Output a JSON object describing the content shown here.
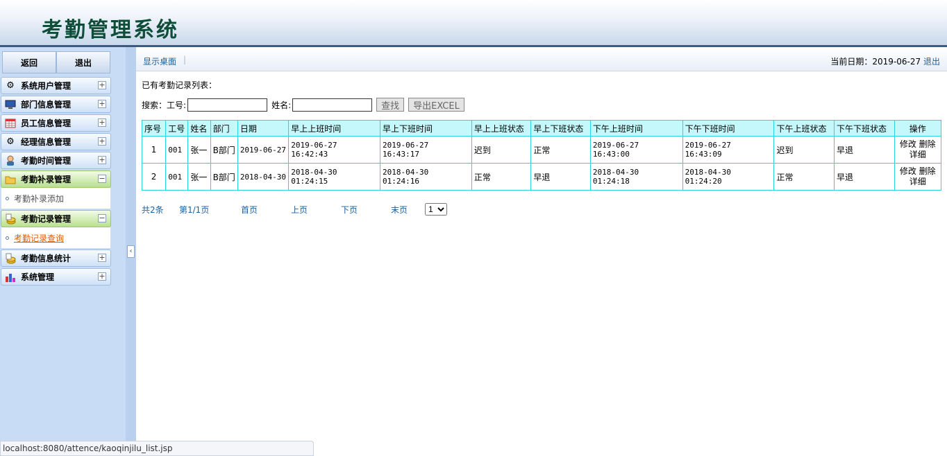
{
  "app": {
    "title": "考勤管理系统"
  },
  "sidebar": {
    "back_label": "返回",
    "exit_label": "退出",
    "menu": [
      {
        "label": "系统用户管理",
        "icon": "gear-icon",
        "state": "collapsed"
      },
      {
        "label": "部门信息管理",
        "icon": "monitor-icon",
        "state": "collapsed"
      },
      {
        "label": "员工信息管理",
        "icon": "calendar-icon",
        "state": "collapsed"
      },
      {
        "label": "经理信息管理",
        "icon": "gear-icon",
        "state": "collapsed"
      },
      {
        "label": "考勤时间管理",
        "icon": "person-icon",
        "state": "collapsed"
      },
      {
        "label": "考勤补录管理",
        "icon": "folder-icon",
        "state": "expanded",
        "sub": "考勤补录添加"
      },
      {
        "label": "考勤记录管理",
        "icon": "coins-icon",
        "state": "expanded",
        "sub": "考勤记录查询"
      },
      {
        "label": "考勤信息统计",
        "icon": "coins-icon",
        "state": "collapsed"
      },
      {
        "label": "系统管理",
        "icon": "chart-icon",
        "state": "collapsed"
      }
    ],
    "collapse_arrow": "‹"
  },
  "breadcrumb": {
    "desk_label": "显示桌面",
    "date_text": "当前日期：2019-06-27",
    "logout_label": "退出"
  },
  "page": {
    "caption": "已有考勤记录列表：",
    "search_label": "搜索：",
    "id_label": "工号:",
    "name_label": "姓名:",
    "id_value": "",
    "name_value": "",
    "search_button": "查找",
    "export_button": "导出EXCEL"
  },
  "table": {
    "headers": [
      "序号",
      "工号",
      "姓名",
      "部门",
      "日期",
      "早上上班时间",
      "早上下班时间",
      "早上上班状态",
      "早上下班状态",
      "下午上班时间",
      "下午下班时间",
      "下午上班状态",
      "下午下班状态",
      "操作"
    ],
    "rows": [
      {
        "cells": [
          "1",
          "001",
          "张一",
          "B部门",
          "2019-06-27",
          "2019-06-27 16:42:43",
          "2019-06-27 16:43:17",
          "迟到",
          "正常",
          "2019-06-27 16:43:00",
          "2019-06-27 16:43:09",
          "迟到",
          "早退"
        ],
        "edit": "修改",
        "delete": "删除",
        "detail": "详细"
      },
      {
        "cells": [
          "2",
          "001",
          "张一",
          "B部门",
          "2018-04-30",
          "2018-04-30 01:24:15",
          "2018-04-30 01:24:16",
          "正常",
          "早退",
          "2018-04-30 01:24:18",
          "2018-04-30 01:24:20",
          "正常",
          "早退"
        ],
        "edit": "修改",
        "delete": "删除",
        "detail": "详细"
      }
    ]
  },
  "pager": {
    "total": "共2条",
    "page_info": "第1/1页",
    "first": "首页",
    "prev": "上页",
    "next": "下页",
    "last": "末页",
    "selected_page": "1"
  },
  "statusbar": {
    "url": "localhost:8080/attence/kaoqinjilu_list.jsp"
  }
}
